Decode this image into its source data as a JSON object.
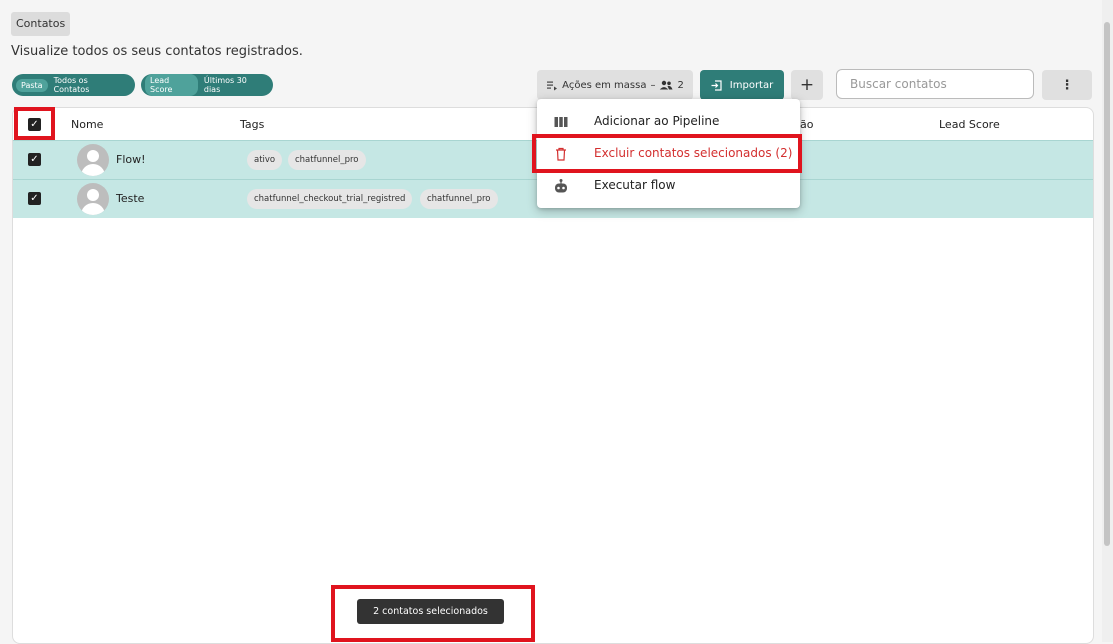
{
  "breadcrumb": {
    "label": "Contatos"
  },
  "page": {
    "subtitle": "Visualize todos os seus contatos registrados."
  },
  "filters": [
    {
      "key": "Pasta",
      "value": "Todos os Contatos"
    },
    {
      "key": "Lead Score",
      "value": "Últimos 30 dias"
    }
  ],
  "toolbar": {
    "bulk_label": "Ações em massa",
    "bulk_separator": "–",
    "bulk_count": "2",
    "import_label": "Importar",
    "add_label": "+",
    "more_label": "⋮"
  },
  "search": {
    "placeholder": "Buscar contatos",
    "value": ""
  },
  "table": {
    "columns": [
      "Nome",
      "Tags",
      "ão",
      "Lead Score"
    ],
    "rows": [
      {
        "name": "Flow!",
        "tags": [
          "ativo",
          "chatfunnel_pro"
        ],
        "checked": true
      },
      {
        "name": "Teste",
        "tags": [
          "chatfunnel_checkout_trial_registred",
          "chatfunnel_pro"
        ],
        "checked": true
      }
    ]
  },
  "bulk_menu": {
    "items": [
      {
        "label": "Adicionar ao Pipeline",
        "icon": "pipeline-columns-icon"
      },
      {
        "label": "Excluir contatos selecionados (2)",
        "icon": "trash-icon",
        "danger": true
      },
      {
        "label": "Executar flow",
        "icon": "robot-icon"
      }
    ]
  },
  "snackbar": {
    "text": "2 contatos selecionados"
  },
  "colors": {
    "accent": "#2f7d78",
    "selected_row": "#c5e7e4",
    "danger": "#d32f2f",
    "highlight": "#e0141e"
  }
}
